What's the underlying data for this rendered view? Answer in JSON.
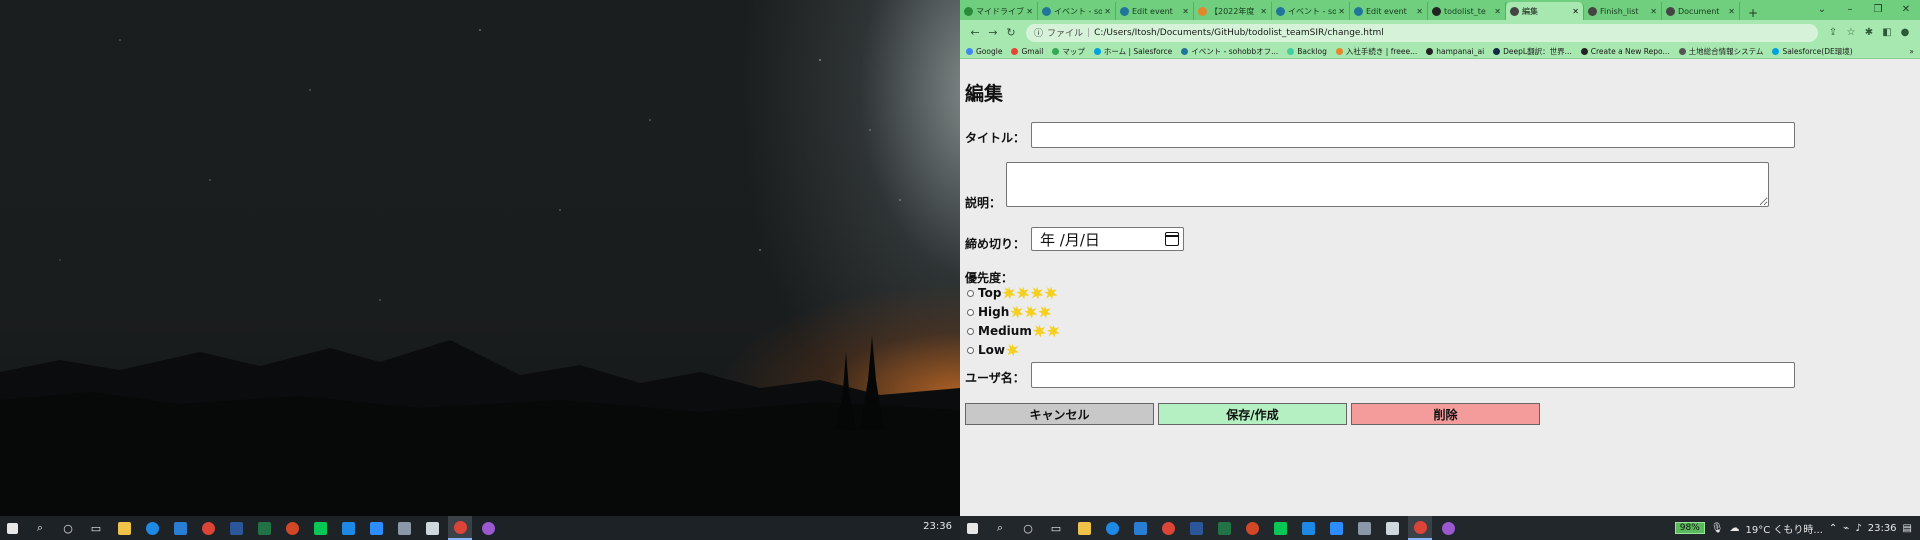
{
  "browser": {
    "tabs": [
      {
        "label": "マイドライブ",
        "icon": "drive-icon",
        "color": "#2a8a3c",
        "active": false
      },
      {
        "label": "イベント - so",
        "icon": "wordpress-icon",
        "color": "#21759b",
        "active": false
      },
      {
        "label": "Edit event",
        "icon": "wordpress-icon",
        "color": "#21759b",
        "active": false
      },
      {
        "label": "【2022年度",
        "icon": "page-icon",
        "color": "#e6862a",
        "active": false
      },
      {
        "label": "イベント - so",
        "icon": "wordpress-icon",
        "color": "#21759b",
        "active": false
      },
      {
        "label": "Edit event",
        "icon": "wordpress-icon",
        "color": "#21759b",
        "active": false
      },
      {
        "label": "todolist_te",
        "icon": "github-icon",
        "color": "#222222",
        "active": false
      },
      {
        "label": "編集",
        "icon": "globe-icon",
        "color": "#444444",
        "active": true
      },
      {
        "label": "Finish_list",
        "icon": "globe-icon",
        "color": "#444444",
        "active": false
      },
      {
        "label": "Document",
        "icon": "globe-icon",
        "color": "#444444",
        "active": false
      }
    ],
    "new_tab": "+",
    "address": {
      "protocol_label": "ファイル",
      "separator": "|",
      "url": "C:/Users/Itosh/Documents/GitHub/todolist_teamSIR/change.html"
    },
    "bookmarks": [
      {
        "label": "Google",
        "color": "#4285f4"
      },
      {
        "label": "Gmail",
        "color": "#ea4335"
      },
      {
        "label": "マップ",
        "color": "#34a853"
      },
      {
        "label": "ホーム | Salesforce",
        "color": "#00a1e0"
      },
      {
        "label": "イベント - sohobbオフ...",
        "color": "#21759b"
      },
      {
        "label": "Backlog",
        "color": "#42ce9f"
      },
      {
        "label": "入社手続き | freee...",
        "color": "#e6862a"
      },
      {
        "label": "hampanai_ai",
        "color": "#222222"
      },
      {
        "label": "DeepL翻訳：世界...",
        "color": "#0f2b46"
      },
      {
        "label": "Create a New Repo...",
        "color": "#222222"
      },
      {
        "label": "土地総合情報システム",
        "color": "#555555"
      },
      {
        "label": "Salesforce(DE環境)",
        "color": "#00a1e0"
      }
    ],
    "more_bookmarks": "»"
  },
  "page": {
    "heading": "編集",
    "title_label": "タイトル：",
    "title_value": "",
    "description_label": "説明：",
    "description_value": "",
    "deadline_label": "締め切り：",
    "deadline_placeholder": "年 /月/日",
    "priority_label": "優先度：",
    "priorities": [
      {
        "label": "Top",
        "bursts": 4
      },
      {
        "label": "High",
        "bursts": 3
      },
      {
        "label": "Medium",
        "bursts": 2
      },
      {
        "label": "Low",
        "bursts": 1
      }
    ],
    "username_label": "ユーザ名：",
    "username_value": "",
    "buttons": {
      "cancel": {
        "label": "キャンセル",
        "color": "#c8c8c8"
      },
      "save": {
        "label": "保存/作成",
        "color": "#b5f0c2"
      },
      "delete": {
        "label": "削除",
        "color": "#f49b9b"
      }
    }
  },
  "taskbar_left": {
    "clock": "23:36"
  },
  "taskbar_right": {
    "battery": "98%",
    "weather": "19°C くもり時...",
    "clock": "23:36"
  }
}
